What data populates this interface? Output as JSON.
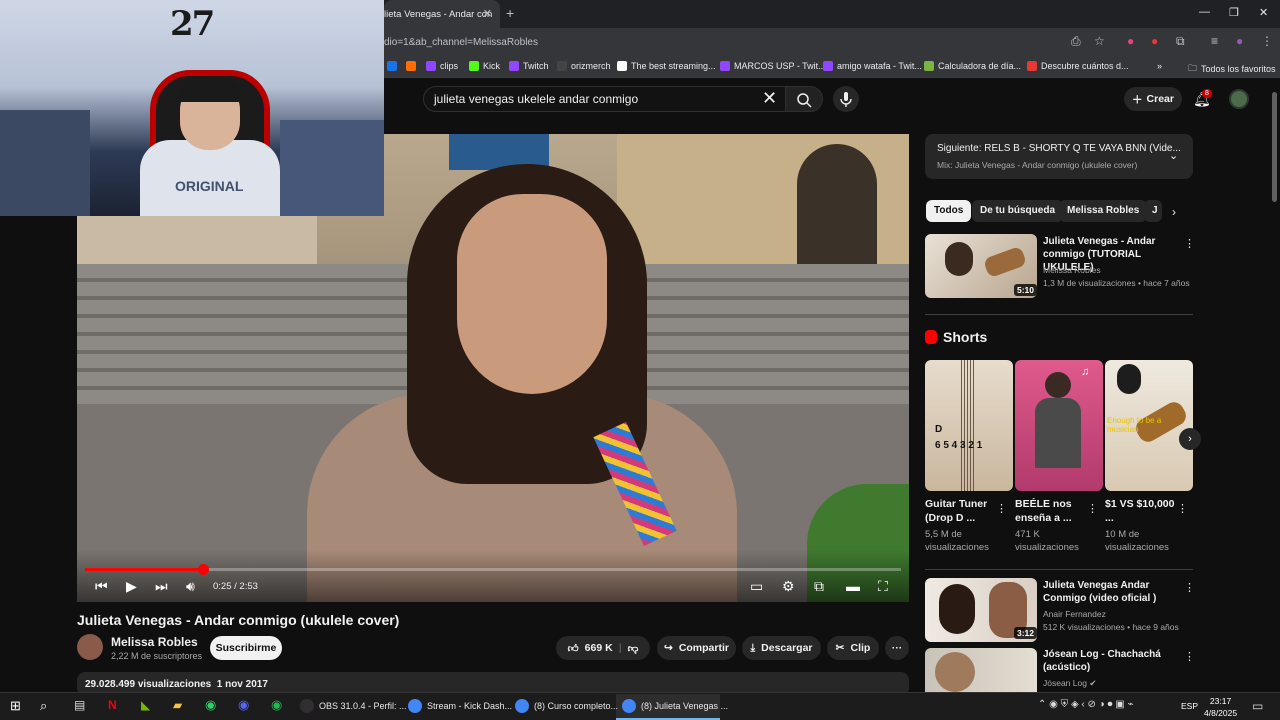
{
  "browser": {
    "active_tab_title": "lieta Venegas - Andar con",
    "url": "dio=1&ab_channel=MelissaRobles",
    "bookmarks": [
      {
        "label": "clips",
        "color": "#9146ff"
      },
      {
        "label": "Kick",
        "color": "#53fc18"
      },
      {
        "label": "Twitch",
        "color": "#9146ff"
      },
      {
        "label": "orizmerch",
        "color": "#444444"
      },
      {
        "label": "The best streaming...",
        "color": "#ffffff"
      },
      {
        "label": "MARCOS USP - Twit...",
        "color": "#9146ff"
      },
      {
        "label": "amigo watafa - Twit...",
        "color": "#9146ff"
      },
      {
        "label": "Calculadora de día...",
        "color": "#7cb342"
      },
      {
        "label": "Descubre cuántos d...",
        "color": "#e53935"
      }
    ],
    "bookmarks_overflow": "»",
    "all_bookmarks_label": "Todos los favoritos"
  },
  "webcam": {
    "wall_text": "27",
    "shirt_text": "ORIGINAL"
  },
  "youtube": {
    "search_query": "julieta venegas ukelele andar conmigo",
    "create_label": "Crear",
    "notifications_count": "8"
  },
  "player": {
    "current_time": "0:25",
    "duration": "2:53",
    "progress_fraction": 0.144,
    "time_display": "0:25 / 2:53"
  },
  "video": {
    "title": "Julieta Venegas - Andar conmigo (ukulele cover)",
    "channel_name": "Melissa Robles",
    "subscribers": "2,22 M de suscriptores",
    "subscribe_label": "Suscribirme",
    "likes": "669 K",
    "share_label": "Compartir",
    "download_label": "Descargar",
    "clip_label": "Clip",
    "more_label": "···",
    "views_date": "29.028.499 visualizaciones  1 nov 2017"
  },
  "sidebar": {
    "up_next_title": "Siguiente: RELS B - SHORTY Q TE VAYA BNN (Vide...",
    "up_next_subtitle": "Mix: Julieta Venegas - Andar conmigo (ukulele cover)",
    "chips": [
      "Todos",
      "De tu búsqueda",
      "Melissa Robles",
      "J"
    ],
    "videos": [
      {
        "title": "Julieta Venegas - Andar conmigo (TUTORIAL UKULELE)",
        "channel": "Melissa Robles",
        "meta": "1,3 M de visualizaciones • hace 7 años",
        "duration": "5:10"
      },
      {
        "title": "Julieta Venegas Andar Conmigo (video oficial )",
        "channel": "Anair Fernandez",
        "meta": "512 K visualizaciones • hace 9 años",
        "duration": "3:12"
      },
      {
        "title": "Jósean Log - Chachachá (acústico)",
        "channel": "Jósean Log",
        "meta": "",
        "duration": ""
      }
    ],
    "shorts_label": "Shorts",
    "shorts": [
      {
        "title": "Guitar Tuner (Drop D ...",
        "views": "5,5 M de visualizaciones",
        "overlay": "D\n6 5 4 3 2 1"
      },
      {
        "title": "BEÉLE nos enseña a ...",
        "views": "471 K visualizaciones",
        "overlay": ""
      },
      {
        "title": "$1 VS $10,000 ...",
        "views": "10 M de visualizaciones",
        "overlay": "Enough to be a musician"
      }
    ]
  },
  "taskbar": {
    "apps": [
      {
        "label": "OBS 31.0.4 - Perfil: ...",
        "color": "#302e31"
      },
      {
        "label": "Stream - Kick Dash...",
        "color": "#4285f4"
      },
      {
        "label": "(8) Curso completo...",
        "color": "#4285f4"
      },
      {
        "label": "(8) Julieta Venegas ...",
        "color": "#4285f4"
      }
    ],
    "language": "ESP",
    "time": "23:17",
    "date": "4/8/2025"
  }
}
